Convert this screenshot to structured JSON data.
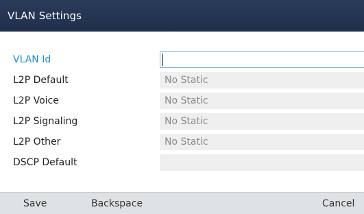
{
  "window": {
    "title": "VLAN Settings"
  },
  "fields": [
    {
      "label": "VLAN Id",
      "value": ""
    },
    {
      "label": "L2P Default",
      "value": "No Static"
    },
    {
      "label": "L2P Voice",
      "value": "No Static"
    },
    {
      "label": "L2P Signaling",
      "value": "No Static"
    },
    {
      "label": "L2P Other",
      "value": "No Static"
    },
    {
      "label": "DSCP Default",
      "value": ""
    }
  ],
  "softkeys": {
    "save": "Save",
    "backspace": "Backspace",
    "cancel": "Cancel"
  },
  "colors": {
    "titlebar": "#22334f",
    "active_label": "#1c8fd0",
    "softkey_bar": "#dfe2e5"
  }
}
